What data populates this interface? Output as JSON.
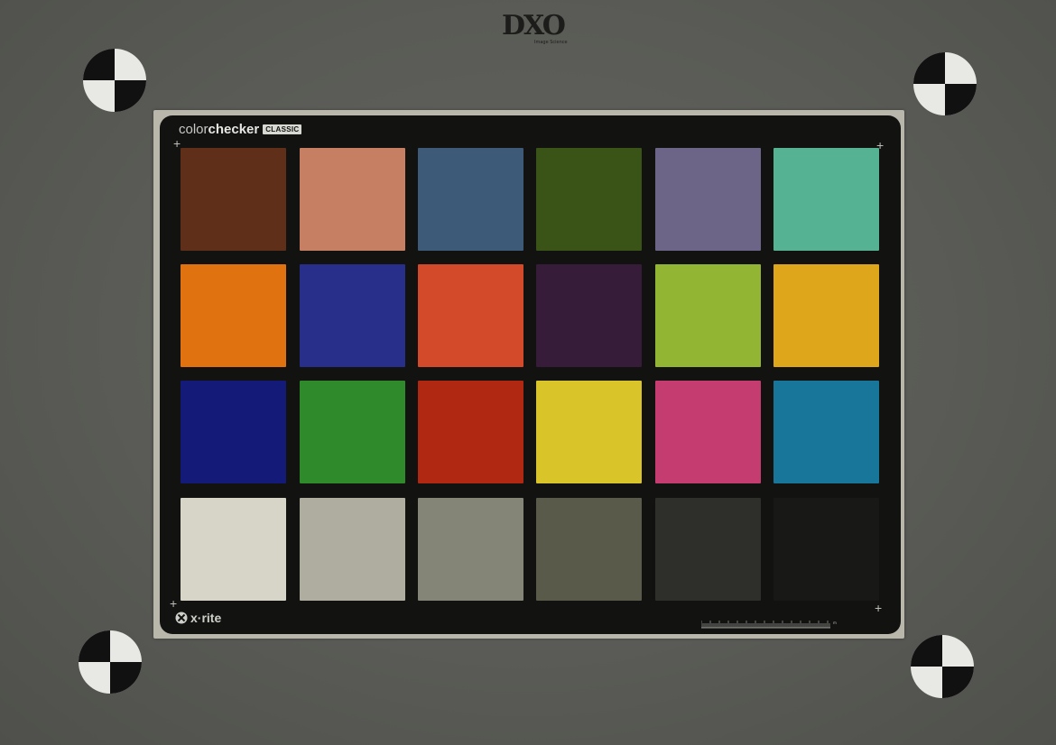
{
  "logo": {
    "text": "DXO",
    "subtitle": "Image Science"
  },
  "card": {
    "brand_light": "color",
    "brand_bold": "checker",
    "brand_badge": "CLASSIC",
    "footer_logo": "x·rite",
    "ruler_unit": "mm"
  },
  "patches": [
    {
      "row": 0,
      "col": 0,
      "color": "#5f2f19"
    },
    {
      "row": 0,
      "col": 1,
      "color": "#c77f63"
    },
    {
      "row": 0,
      "col": 2,
      "color": "#3d5b78"
    },
    {
      "row": 0,
      "col": 3,
      "color": "#3a5317"
    },
    {
      "row": 0,
      "col": 4,
      "color": "#6c6588"
    },
    {
      "row": 0,
      "col": 5,
      "color": "#55b292"
    },
    {
      "row": 1,
      "col": 0,
      "color": "#e0720f"
    },
    {
      "row": 1,
      "col": 1,
      "color": "#282f8a"
    },
    {
      "row": 1,
      "col": 2,
      "color": "#d24a2a"
    },
    {
      "row": 1,
      "col": 3,
      "color": "#361c38"
    },
    {
      "row": 1,
      "col": 4,
      "color": "#92b534"
    },
    {
      "row": 1,
      "col": 5,
      "color": "#dea61a"
    },
    {
      "row": 2,
      "col": 0,
      "color": "#141a78"
    },
    {
      "row": 2,
      "col": 1,
      "color": "#2e8a2a"
    },
    {
      "row": 2,
      "col": 2,
      "color": "#b12812"
    },
    {
      "row": 2,
      "col": 3,
      "color": "#d9c42a"
    },
    {
      "row": 2,
      "col": 4,
      "color": "#c43c70"
    },
    {
      "row": 2,
      "col": 5,
      "color": "#17769a"
    },
    {
      "row": 3,
      "col": 0,
      "color": "#d6d5c8"
    },
    {
      "row": 3,
      "col": 1,
      "color": "#aeada0"
    },
    {
      "row": 3,
      "col": 2,
      "color": "#848576"
    },
    {
      "row": 3,
      "col": 3,
      "color": "#5a5a4a"
    },
    {
      "row": 3,
      "col": 4,
      "color": "#2e2f2b"
    },
    {
      "row": 3,
      "col": 5,
      "color": "#181817"
    }
  ],
  "colors": {
    "background": "#5b5c57",
    "card": "#121211",
    "mount": "#b9b6ac"
  }
}
